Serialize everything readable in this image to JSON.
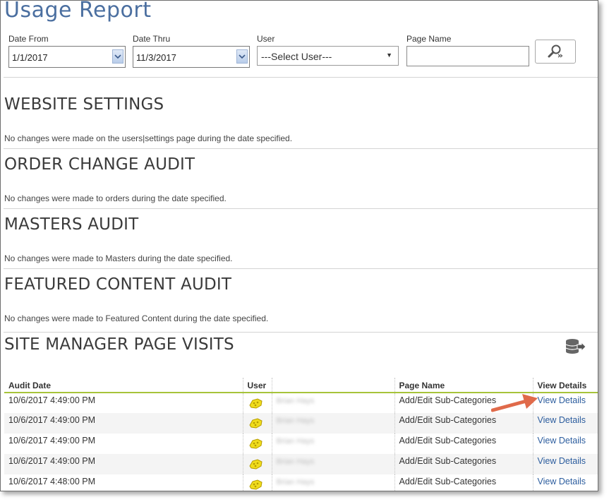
{
  "page": {
    "title": "Usage Report"
  },
  "filters": {
    "date_from": {
      "label": "Date From",
      "value": "1/1/2017"
    },
    "date_thru": {
      "label": "Date Thru",
      "value": "11/3/2017"
    },
    "user": {
      "label": "User",
      "selected": "---Select User---"
    },
    "page_name": {
      "label": "Page Name",
      "value": ""
    }
  },
  "sections": [
    {
      "title": "WEBSITE SETTINGS",
      "message": "No changes were made on the users|settings page during the date specified."
    },
    {
      "title": "ORDER CHANGE AUDIT",
      "message": "No changes were made to orders during the date specified."
    },
    {
      "title": "MASTERS AUDIT",
      "message": "No changes were made to Masters during the date specified."
    },
    {
      "title": "FEATURED CONTENT AUDIT",
      "message": "No changes were made to Featured Content during the date specified."
    }
  ],
  "visits": {
    "title": "SITE MANAGER PAGE VISITS",
    "export_icon": "database-export-icon",
    "columns": [
      "Audit Date",
      "User",
      "",
      "Page Name",
      "View Details"
    ],
    "rows": [
      {
        "date": "10/6/2017 4:49:00 PM",
        "user_name": "Brian Hays",
        "page": "Add/Edit Sub-Categories",
        "link": "View Details"
      },
      {
        "date": "10/6/2017 4:49:00 PM",
        "user_name": "Brian Hays",
        "page": "Add/Edit Sub-Categories",
        "link": "View Details"
      },
      {
        "date": "10/6/2017 4:49:00 PM",
        "user_name": "Brian Hays",
        "page": "Add/Edit Sub-Categories",
        "link": "View Details"
      },
      {
        "date": "10/6/2017 4:49:00 PM",
        "user_name": "Brian Hays",
        "page": "Add/Edit Sub-Categories",
        "link": "View Details"
      },
      {
        "date": "10/6/2017 4:48:00 PM",
        "user_name": "Brian Hays",
        "page": "Add/Edit Sub-Categories",
        "link": "View Details"
      }
    ]
  },
  "colors": {
    "title_blue": "#4b6fa0",
    "link_blue": "#2c5d9e",
    "header_rule": "#a7c43a",
    "annotation_arrow": "#e06a4a"
  }
}
